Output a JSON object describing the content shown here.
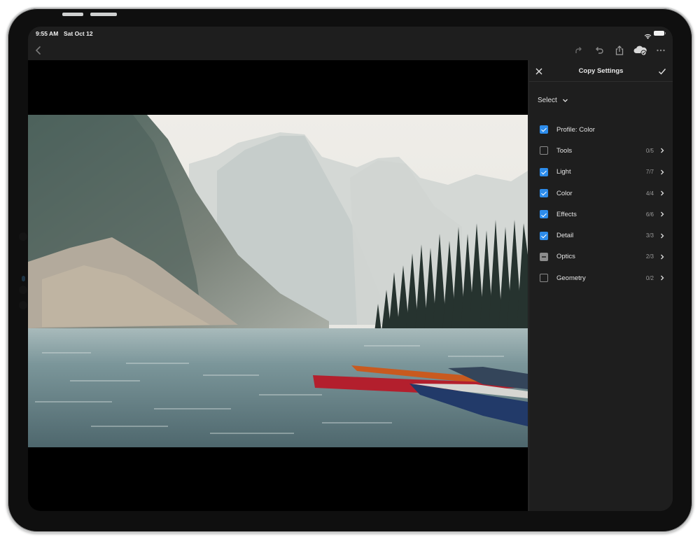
{
  "status_bar": {
    "time": "9:55 AM",
    "date": "Sat Oct 12",
    "icons": [
      "wifi-icon",
      "battery-icon"
    ]
  },
  "toolbar": {
    "left_icons": [
      "back-icon"
    ],
    "right_icons": [
      "redo-icon",
      "undo-icon",
      "share-icon",
      "cloud-synced-icon",
      "more-icon"
    ]
  },
  "photo": {
    "description": "Misty mountain lake with pine forest and canoes (red, orange, blue) moored at the shore"
  },
  "panel": {
    "title": "Copy Settings",
    "close_icon": "close-icon",
    "confirm_icon": "checkmark-icon",
    "select_label": "Select",
    "items": [
      {
        "label": "Profile: Color",
        "state": "checked",
        "count": "",
        "has_chevron": false
      },
      {
        "label": "Tools",
        "state": "unchecked",
        "count": "0/5",
        "has_chevron": true
      },
      {
        "label": "Light",
        "state": "checked",
        "count": "7/7",
        "has_chevron": true
      },
      {
        "label": "Color",
        "state": "checked",
        "count": "4/4",
        "has_chevron": true
      },
      {
        "label": "Effects",
        "state": "checked",
        "count": "6/6",
        "has_chevron": true
      },
      {
        "label": "Detail",
        "state": "checked",
        "count": "3/3",
        "has_chevron": true
      },
      {
        "label": "Optics",
        "state": "partial",
        "count": "2/3",
        "has_chevron": true
      },
      {
        "label": "Geometry",
        "state": "unchecked",
        "count": "0/2",
        "has_chevron": true
      }
    ]
  },
  "colors": {
    "accent": "#2d8ceb",
    "panel_bg": "#1e1e1e",
    "canvas_bg": "#000000",
    "text_primary": "#e4e4e4",
    "text_secondary": "#9a9a9a"
  }
}
